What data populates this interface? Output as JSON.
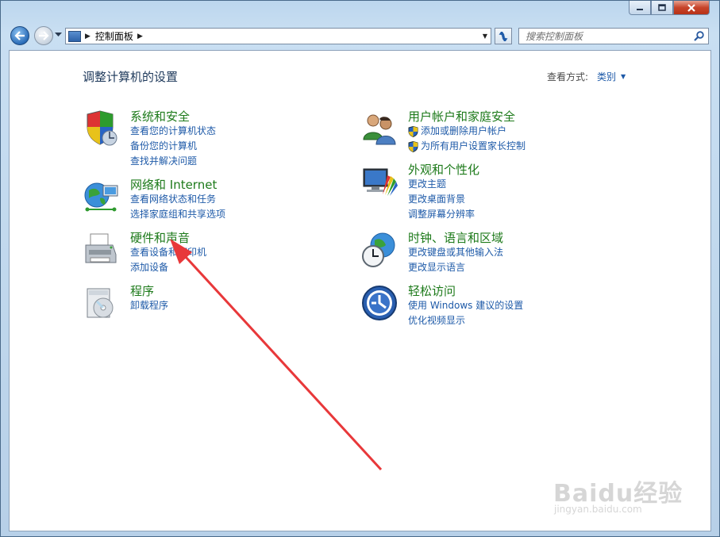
{
  "toolbar": {
    "breadcrumb": "控制面板",
    "search_placeholder": "搜索控制面板"
  },
  "main": {
    "title": "调整计算机的设置",
    "view_by_label": "查看方式:",
    "view_by_value": "类别"
  },
  "categories": [
    {
      "title": "系统和安全",
      "links": [
        "查看您的计算机状态",
        "备份您的计算机",
        "查找并解决问题"
      ]
    },
    {
      "title": "用户帐户和家庭安全",
      "links": [
        "添加或删除用户帐户",
        "为所有用户设置家长控制"
      ]
    },
    {
      "title": "网络和 Internet",
      "links": [
        "查看网络状态和任务",
        "选择家庭组和共享选项"
      ]
    },
    {
      "title": "外观和个性化",
      "links": [
        "更改主题",
        "更改桌面背景",
        "调整屏幕分辨率"
      ]
    },
    {
      "title": "硬件和声音",
      "links": [
        "查看设备和打印机",
        "添加设备"
      ]
    },
    {
      "title": "时钟、语言和区域",
      "links": [
        "更改键盘或其他输入法",
        "更改显示语言"
      ]
    },
    {
      "title": "程序",
      "links": [
        "卸载程序"
      ]
    },
    {
      "title": "轻松访问",
      "links": [
        "使用 Windows 建议的设置",
        "优化视频显示"
      ]
    }
  ],
  "watermark": {
    "brand": "Baidu经验",
    "site": "jingyan.baidu.com"
  },
  "colors": {
    "link": "#1e5aa8",
    "category_title": "#1d7a1a",
    "annotation_arrow": "#e8383a"
  }
}
